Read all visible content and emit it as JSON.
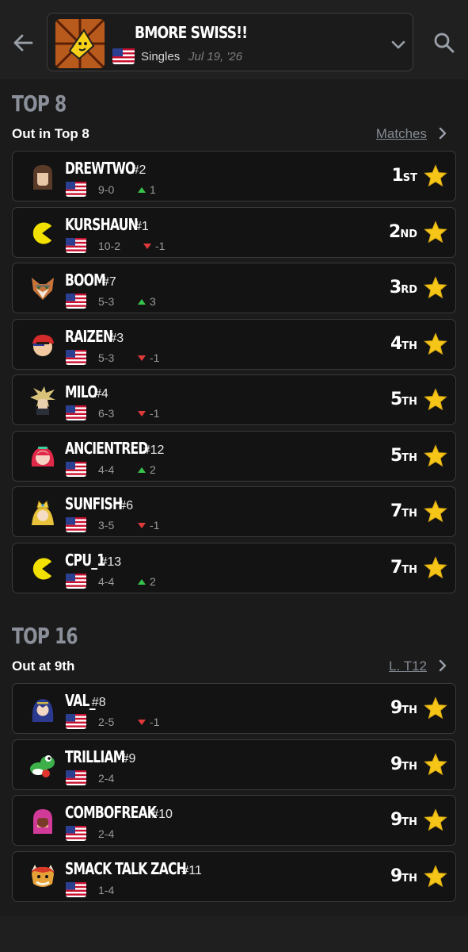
{
  "header": {
    "event_title": "BMORE SWISS!!",
    "event_type": "Singles",
    "event_date": "Jul 19, '26",
    "flag": "us-flag",
    "back_icon": "back-arrow-icon",
    "expand_icon": "chevron-down-icon",
    "search_icon": "search-icon"
  },
  "colors": {
    "accent_title": "#8a8f99",
    "star": "#f5c518",
    "up": "#37c24b",
    "down": "#e0393a"
  },
  "sections": [
    {
      "title": "TOP 8",
      "subtitle": "Out in Top 8",
      "link": "Matches",
      "players": [
        {
          "name": "DREWTWO",
          "seed": "#2",
          "record": "9-0",
          "trend_dir": "up",
          "trend": "1",
          "place": "1",
          "suffix": "ST",
          "avatar": "brown-hair-character-icon"
        },
        {
          "name": "KURSHAUN",
          "seed": "#1",
          "record": "10-2",
          "trend_dir": "down",
          "trend": "-1",
          "place": "2",
          "suffix": "ND",
          "avatar": "pacman-icon"
        },
        {
          "name": "BOOM",
          "seed": "#7",
          "record": "5-3",
          "trend_dir": "up",
          "trend": "3",
          "place": "3",
          "suffix": "RD",
          "avatar": "fox-icon"
        },
        {
          "name": "RAIZEN",
          "seed": "#3",
          "record": "5-3",
          "trend_dir": "down",
          "trend": "-1",
          "place": "4",
          "suffix": "TH",
          "avatar": "red-cap-character-icon"
        },
        {
          "name": "MILO",
          "seed": "#4",
          "record": "6-3",
          "trend_dir": "down",
          "trend": "-1",
          "place": "5",
          "suffix": "TH",
          "avatar": "spiky-blond-character-icon"
        },
        {
          "name": "ANCIENTRED",
          "seed": "#12",
          "record": "4-4",
          "trend_dir": "up",
          "trend": "2",
          "place": "5",
          "suffix": "TH",
          "avatar": "red-hair-character-icon"
        },
        {
          "name": "SUNFISH",
          "seed": "#6",
          "record": "3-5",
          "trend_dir": "down",
          "trend": "-1",
          "place": "7",
          "suffix": "TH",
          "avatar": "crowned-princess-icon"
        },
        {
          "name": "CPU_1",
          "seed": "#13",
          "record": "4-4",
          "trend_dir": "up",
          "trend": "2",
          "place": "7",
          "suffix": "TH",
          "avatar": "pacman-icon"
        }
      ]
    },
    {
      "title": "TOP 16",
      "subtitle": "Out at 9th",
      "link": "L. T12",
      "players": [
        {
          "name": "VAL_",
          "seed": "#8",
          "record": "2-5",
          "trend_dir": "down",
          "trend": "-1",
          "place": "9",
          "suffix": "TH",
          "avatar": "blue-hair-character-icon"
        },
        {
          "name": "TRILLIAM",
          "seed": "#9",
          "record": "2-4",
          "trend_dir": "",
          "trend": "",
          "place": "9",
          "suffix": "TH",
          "avatar": "yoshi-icon"
        },
        {
          "name": "COMBOFREAK",
          "seed": "#10",
          "record": "2-4",
          "trend_dir": "",
          "trend": "",
          "place": "9",
          "suffix": "TH",
          "avatar": "pink-hood-character-icon"
        },
        {
          "name": "SMACK TALK ZACH",
          "seed": "#11",
          "record": "1-4",
          "trend_dir": "",
          "trend": "",
          "place": "9",
          "suffix": "TH",
          "avatar": "bowser-icon"
        }
      ]
    }
  ]
}
